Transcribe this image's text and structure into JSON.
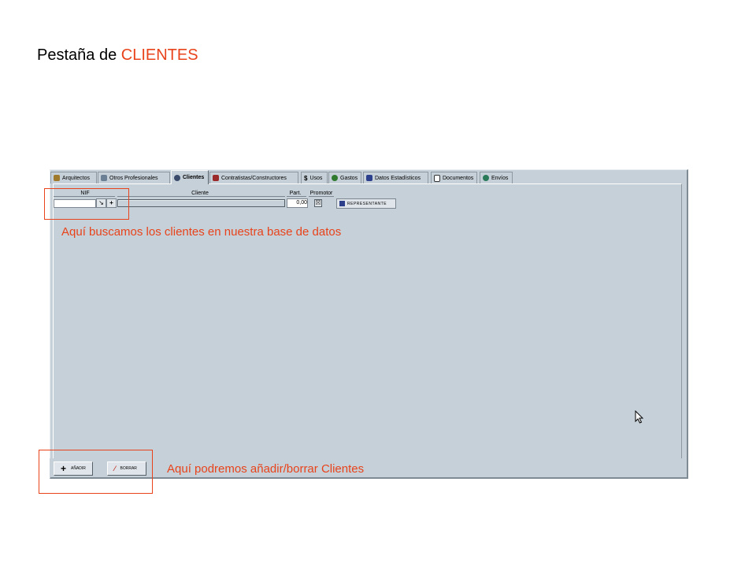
{
  "heading": {
    "prefix": "Pestaña de ",
    "highlight": "CLIENTES"
  },
  "tabs": [
    {
      "label": "Arquitectos",
      "icon": "architect-icon"
    },
    {
      "label": "Otros Profesionales",
      "icon": "folder-icon"
    },
    {
      "label": "Clientes",
      "icon": "client-icon",
      "active": true
    },
    {
      "label": "Contratistas/Constructores",
      "icon": "builder-icon"
    },
    {
      "label": "Usos",
      "icon": "dollar-icon"
    },
    {
      "label": "Gastos",
      "icon": "money-bag-icon"
    },
    {
      "label": "Datos Estadísticos",
      "icon": "bar-chart-icon"
    },
    {
      "label": "Documentos",
      "icon": "document-icon"
    },
    {
      "label": "Envíos",
      "icon": "send-icon"
    }
  ],
  "columns": {
    "nif": "NIF",
    "cliente": "Cliente",
    "part": "Part.",
    "promotor": "Promotor"
  },
  "row": {
    "part_value": "0,00",
    "promotor_mark": "☒"
  },
  "buttons": {
    "representante": "REPRESENTANTE",
    "anadir": "AÑADIR",
    "borrar": "BORRAR"
  },
  "annotations": {
    "search": "Aquí buscamos los clientes en nuestra base de datos",
    "add_delete": "Aquí podremos añadir/borrar Clientes"
  },
  "colors": {
    "annotation": "#e8431b",
    "panel": "#c6d0d8"
  }
}
